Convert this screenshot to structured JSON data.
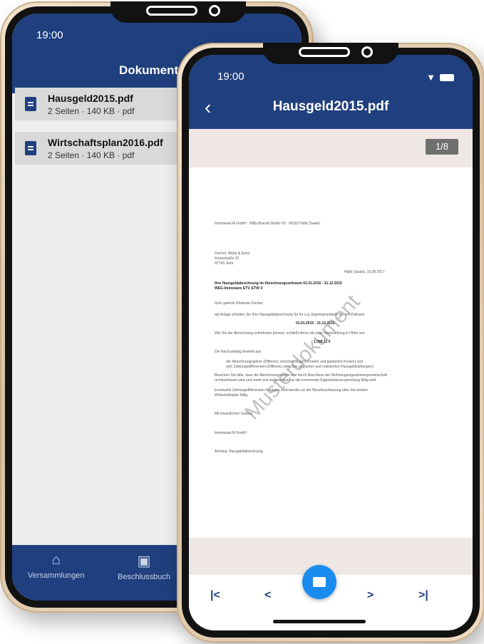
{
  "back_phone": {
    "status_time": "19:00",
    "header_title": "Dokumente",
    "documents": [
      {
        "name": "Hausgeld2015.pdf",
        "meta": "2 Seiten · 140 KB · pdf"
      },
      {
        "name": "Wirtschaftsplan2016.pdf",
        "meta": "2 Seiten · 140 KB · pdf"
      }
    ],
    "tabs": [
      {
        "label": "Versammlungen",
        "icon": "home-icon"
      },
      {
        "label": "Beschlussbuch",
        "icon": "book-icon"
      }
    ]
  },
  "front_phone": {
    "status_time": "19:00",
    "header_title": "Hausgeld2015.pdf",
    "page_indicator": "1/8",
    "watermark": "Musterdokument",
    "pdf_lines": {
      "sender": "Immoware24 GmbH · Willy-Brandt-Straße 59 · 06110 Halle (Saale)",
      "recipient1": "Fischer, Maria & Ernst",
      "recipient2": "Kreuzstraße 15",
      "recipient3": "07743 Jena",
      "date": "Halle (Saale), 16.09.2017",
      "subject1": "Ihre Hausgeldabrechnung im Abrechnungszeitraum 01.01.2015 - 31.12.2015",
      "subject2": "WEG-Immoware ETV, ETW 4",
      "salutation": "Sehr geehrte Eheleute Fischer,",
      "intro": "als Anlage erhalten Sie Ihre Hausgeldabrechnung für Ihr o.g. Eigentumsobjekt für den Zeitraum",
      "period": "01.01.2015 - 31.12.2015",
      "result_text": "Wie Sie der Abrechnung entnehmen können, schließt diese mit einer Nachzahlung in Höhe von",
      "amount": "1.088,12 €",
      "consists": "Die Nachzahlung besteht aus",
      "bullet1": "der Abrechnungsspitze (Differenz zwischen angerechneten und geplanten Kosten) und",
      "bullet2": "evtl. Zahlungsdifferenzen (Differenz zwischen geplanten und realisierten Hausgeldzahlungen)",
      "note1": "Beachten Sie bitte, dass die Abrechnungsspitze erst durch Beschluss der Wohnungseigentümergemeinschaft",
      "note2": "rechtswirksam wird und somit erst im Anschluss an die kommende Eigentümerversammlung fällig wird.",
      "note3": "Eventuelle Zahlungsdifferenzen hingegen sind bereits vor der Beschlussfassung über den letzten",
      "note4": "Wirtschaftsplan fällig.",
      "greeting": "Mit freundlichen Grüßen",
      "company": "Immoware24 GmbH",
      "attachment": "Anhang: Hausgeldabrechnung"
    },
    "pager": {
      "first": "|<",
      "prev": "<",
      "next": ">",
      "last": ">|"
    }
  }
}
